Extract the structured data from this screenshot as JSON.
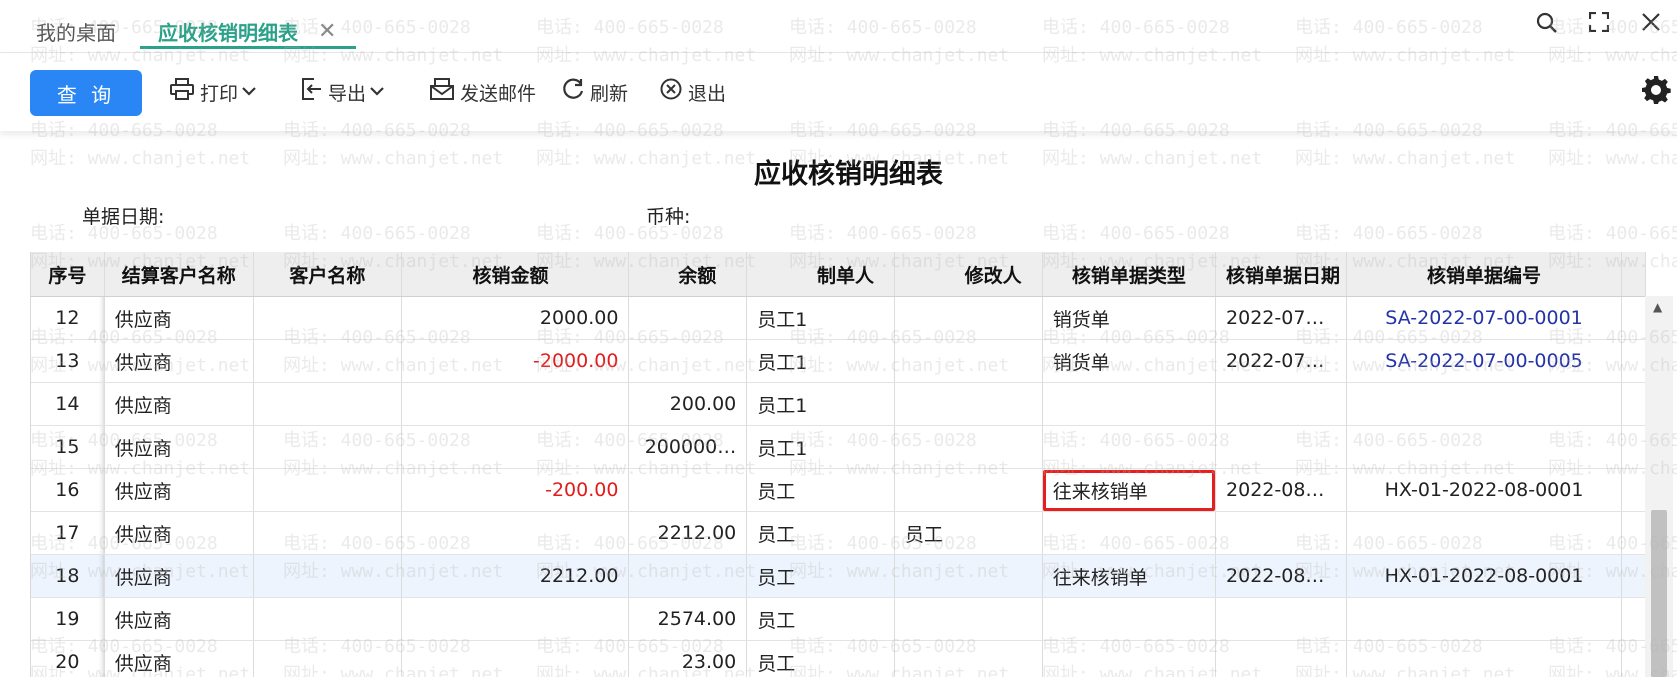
{
  "tabs": {
    "desktop_label": "我的桌面",
    "active_label": "应收核销明细表",
    "close_glyph": "✕"
  },
  "window_icons": [
    "search-icon",
    "fullscreen-icon",
    "close-icon"
  ],
  "toolbar": {
    "query_label": "查 询",
    "print_label": "打印",
    "export_label": "导出",
    "email_label": "发送邮件",
    "refresh_label": "刷新",
    "exit_label": "退出"
  },
  "report": {
    "title": "应收核销明细表",
    "date_label": "单据日期:",
    "currency_label": "币种:"
  },
  "watermark": {
    "phone": "电话: 400-665-0028",
    "site": "网址: www.chanjet.net"
  },
  "table": {
    "columns": [
      "序号",
      "结算客户名称",
      "客户名称",
      "核销金额",
      "余额",
      "制单人",
      "修改人",
      "核销单据类型",
      "核销单据日期",
      "核销单据编号"
    ],
    "rows": [
      {
        "no": "12",
        "settle": "供应商",
        "customer": "",
        "amount": "2000.00",
        "balance": "",
        "creator": "员工1",
        "modifier": "",
        "type": "销货单",
        "date": "2022-07…",
        "code": "SA-2022-07-00-0001",
        "neg": false,
        "link": true
      },
      {
        "no": "13",
        "settle": "供应商",
        "customer": "",
        "amount": "-2000.00",
        "balance": "",
        "creator": "员工1",
        "modifier": "",
        "type": "销货单",
        "date": "2022-07…",
        "code": "SA-2022-07-00-0005",
        "neg": true,
        "link": true
      },
      {
        "no": "14",
        "settle": "供应商",
        "customer": "",
        "amount": "",
        "balance": "200.00",
        "creator": "员工1",
        "modifier": "",
        "type": "",
        "date": "",
        "code": "",
        "neg": false,
        "link": false
      },
      {
        "no": "15",
        "settle": "供应商",
        "customer": "",
        "amount": "",
        "balance": "200000…",
        "creator": "员工1",
        "modifier": "",
        "type": "",
        "date": "",
        "code": "",
        "neg": false,
        "link": false
      },
      {
        "no": "16",
        "settle": "供应商",
        "customer": "",
        "amount": "-200.00",
        "balance": "",
        "creator": "员工",
        "modifier": "",
        "type": "往来核销单",
        "date": "2022-08…",
        "code": "HX-01-2022-08-0001",
        "neg": true,
        "link": false,
        "highlight": true
      },
      {
        "no": "17",
        "settle": "供应商",
        "customer": "",
        "amount": "",
        "balance": "2212.00",
        "creator": "员工",
        "modifier": "员工",
        "type": "",
        "date": "",
        "code": "",
        "neg": false,
        "link": false
      },
      {
        "no": "18",
        "settle": "供应商",
        "customer": "",
        "amount": "2212.00",
        "balance": "",
        "creator": "员工",
        "modifier": "",
        "type": "往来核销单",
        "date": "2022-08…",
        "code": "HX-01-2022-08-0001",
        "neg": false,
        "link": false,
        "selected": true
      },
      {
        "no": "19",
        "settle": "供应商",
        "customer": "",
        "amount": "",
        "balance": "2574.00",
        "creator": "员工",
        "modifier": "",
        "type": "",
        "date": "",
        "code": "",
        "neg": false,
        "link": false
      },
      {
        "no": "20",
        "settle": "供应商",
        "customer": "",
        "amount": "",
        "balance": "23.00",
        "creator": "员工",
        "modifier": "",
        "type": "",
        "date": "",
        "code": "",
        "neg": false,
        "link": false
      }
    ]
  }
}
